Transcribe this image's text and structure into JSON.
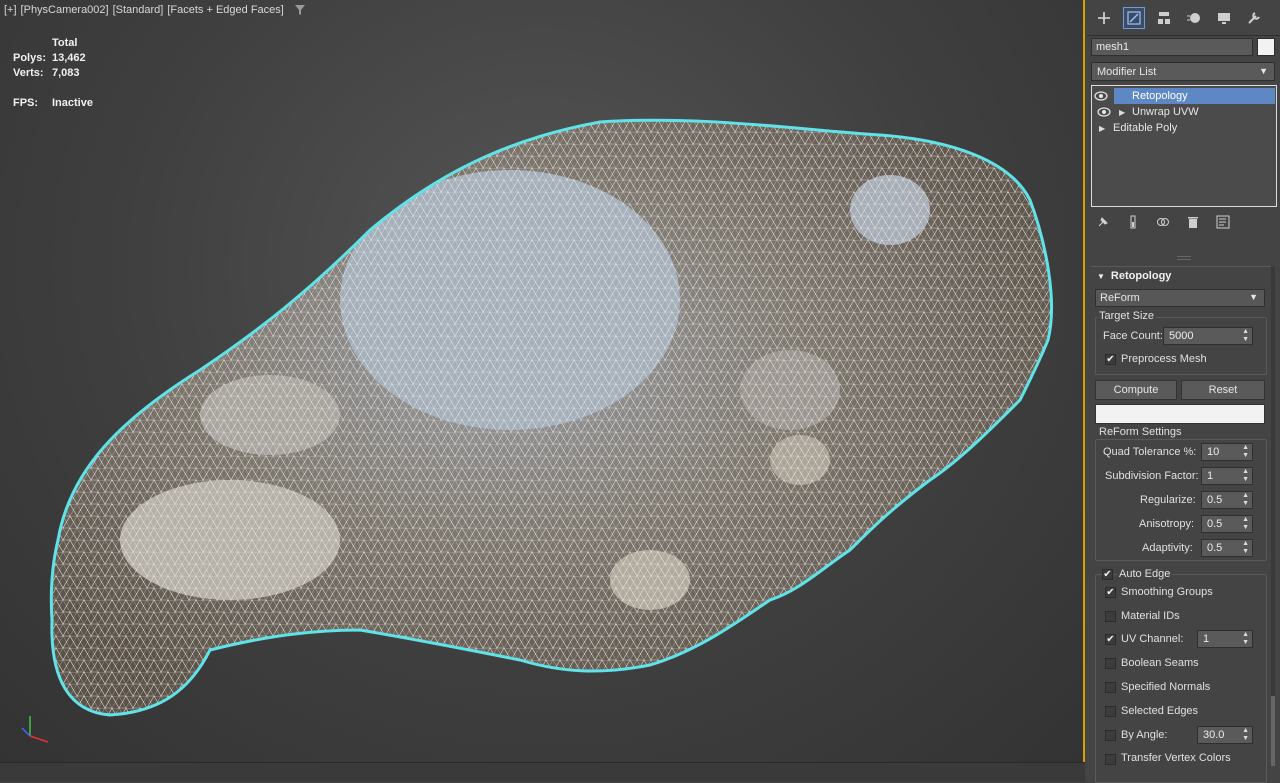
{
  "viewport": {
    "label_parts": [
      "[+]",
      "[PhysCamera002]",
      "[Standard]",
      "[Facets + Edged Faces]"
    ],
    "filter_icon": "funnel-icon",
    "stats": {
      "header": "Total",
      "polys_label": "Polys:",
      "polys_value": "13,462",
      "verts_label": "Verts:",
      "verts_value": "7,083",
      "fps_label": "FPS:",
      "fps_value": "Inactive"
    },
    "selection_color": "#5fe3e8",
    "frame_color": "#d8a000"
  },
  "panel": {
    "toolbar_icons": [
      "create-icon",
      "modify-icon",
      "hierarchy-icon",
      "motion-icon",
      "display-icon",
      "utilities-icon"
    ],
    "object_name": "mesh1",
    "modifier_list": "Modifier List",
    "stack": [
      {
        "label": "Retopology",
        "selected": true
      },
      {
        "label": "Unwrap UVW",
        "selected": false
      },
      {
        "label": "Editable Poly",
        "selected": false
      }
    ],
    "stack_tools": [
      "pin-stack-icon",
      "show-end-result-icon",
      "make-unique-icon",
      "remove-modifier-icon",
      "configure-sets-icon"
    ],
    "rollout": {
      "title": "Retopology",
      "method": "ReForm",
      "target_size_label": "Target Size",
      "face_count_label": "Face Count:",
      "face_count_value": "5000",
      "preprocess_label": "Preprocess Mesh",
      "preprocess_checked": true,
      "compute_label": "Compute",
      "reset_label": "Reset",
      "progress": 0,
      "reform_settings_label": "ReForm Settings",
      "quad_tol_label": "Quad Tolerance %:",
      "quad_tol_value": "10",
      "subdiv_label": "Subdivision Factor:",
      "subdiv_value": "1",
      "regularize_label": "Regularize:",
      "regularize_value": "0.5",
      "anisotropy_label": "Anisotropy:",
      "anisotropy_value": "0.5",
      "adaptivity_label": "Adaptivity:",
      "adaptivity_value": "0.5",
      "auto_edge_label": "Auto Edge",
      "auto_edge_checked": true,
      "smoothing_label": "Smoothing Groups",
      "smoothing_checked": true,
      "material_ids_label": "Material IDs",
      "material_ids_checked": false,
      "uv_channel_label": "UV Channel:",
      "uv_channel_checked": true,
      "uv_channel_value": "1",
      "boolean_seams_label": "Boolean Seams",
      "boolean_seams_checked": false,
      "specified_normals_label": "Specified Normals",
      "specified_normals_checked": false,
      "selected_edges_label": "Selected Edges",
      "selected_edges_checked": false,
      "by_angle_label": "By Angle:",
      "by_angle_checked": false,
      "by_angle_value": "30.0",
      "transfer_label": "Transfer Vertex Colors",
      "transfer_checked": false
    },
    "active_color": "#5e88c4"
  }
}
